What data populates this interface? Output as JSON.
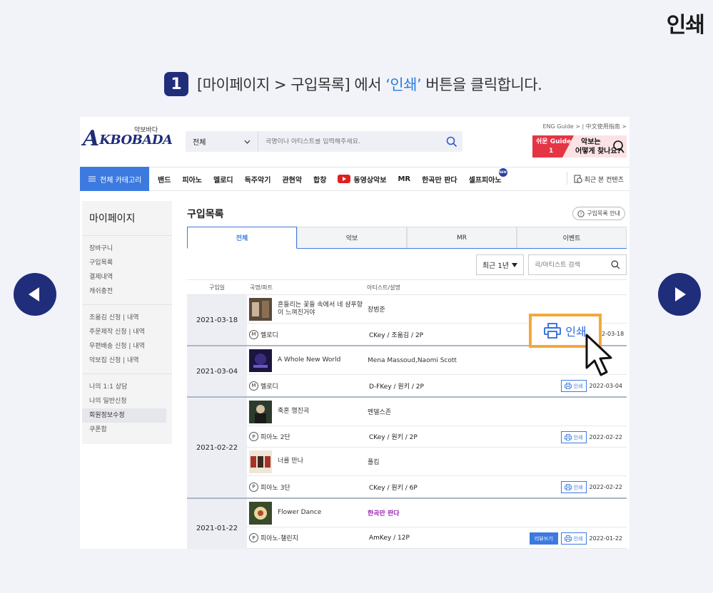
{
  "page": {
    "heading": "인쇄",
    "instruction": {
      "step": "1",
      "prefix": "[마이페이지 > 구입목록] 에서 ",
      "highlight": "‘인쇄’",
      "suffix": " 버튼을 클릭합니다."
    },
    "colors": {
      "navy": "#1f2d7a",
      "accent_blue": "#2b7de0",
      "highlight_orange": "#f3a83b"
    },
    "nav": {
      "prev_icon": "chevron-left-icon",
      "next_icon": "chevron-right-icon"
    }
  },
  "site": {
    "logo": {
      "mark": "A",
      "text": "KBOBADA",
      "sub": "악보바다"
    },
    "search": {
      "category": "전체",
      "placeholder": "곡명이나 아티스트를 입력해주세요."
    },
    "toplinks": "ENG Guide >   |   中文使用指南 >",
    "guide": {
      "red_line1": "쉬운 Guide",
      "red_line2": "1",
      "pink_line1": "악보는",
      "pink_line2": "어떻게 찾나요?"
    },
    "category_button": "전체 카테고리",
    "menu": [
      "밴드",
      "피아노",
      "멜로디",
      "독주악기",
      "관현악",
      "합창",
      "동영상악보",
      "MR",
      "한곡만 판다",
      "셀프피아노"
    ],
    "new_badge": "NEW",
    "recent": "최근 본 컨텐츠"
  },
  "sidebar": {
    "title": "마이페이지",
    "groups": [
      [
        "장바구니",
        "구입목록",
        "결제내역",
        "캐쉬충전"
      ],
      [
        "조옮김 신청    |  내역",
        "주문제작 신청  |  내역",
        "우편배송 신청  |  내역",
        "악보집 신청    |  내역"
      ],
      [
        "나의 1:1 상담",
        "나의 일반신청",
        "회원정보수정",
        "쿠폰함"
      ]
    ],
    "active": "회원정보수정"
  },
  "main": {
    "title": "구입목록",
    "guide_button": "구입목록 안내",
    "tabs": [
      "전체",
      "악보",
      "MR",
      "이벤트"
    ],
    "active_tab": "전체",
    "period": "최근 1년",
    "filter_placeholder": "곡/아티스트 검색",
    "columns": [
      "구입일",
      "곡명/파트",
      "아티스트/설명"
    ],
    "print_label": "인쇄",
    "review_label": "리뷰쓰기",
    "groups": [
      {
        "date": "2021-03-18",
        "items": [
          {
            "title": "흔들리는 꽃들 속에서 네 샴푸향이 느껴진거야",
            "artist": "장범준",
            "part_icon": "M",
            "part": "멜로디",
            "key": "CKey / 조옮김  / 2P",
            "date": "2022-03-18"
          }
        ]
      },
      {
        "date": "2021-03-04",
        "items": [
          {
            "title": "A Whole New World",
            "artist": "Mena Massoud,Naomi Scott",
            "part_icon": "M",
            "part": "멜로디",
            "key": "D-FKey / 원키  / 2P",
            "date": "2022-03-04"
          }
        ]
      },
      {
        "date": "2021-02-22",
        "items": [
          {
            "title": "축혼 행진곡",
            "artist": "멘델스존",
            "part_icon": "P",
            "part": "피아노 2단",
            "key": "CKey / 원키  / 2P",
            "date": "2022-02-22"
          },
          {
            "title": "너를 만나",
            "artist": "폴킴",
            "part_icon": "P",
            "part": "피아노 3단",
            "key": "CKey / 원키  / 6P",
            "date": "2022-02-22"
          }
        ]
      },
      {
        "date": "2021-01-22",
        "items": [
          {
            "title": "Flower Dance",
            "artist": "한곡만 판다",
            "part_icon": "P",
            "part": "피아노-챌린지",
            "key": "AmKey / 12P",
            "date": "2022-01-22"
          }
        ]
      }
    ],
    "callout": {
      "label": "인쇄",
      "partial_date": "2-03-18"
    }
  }
}
